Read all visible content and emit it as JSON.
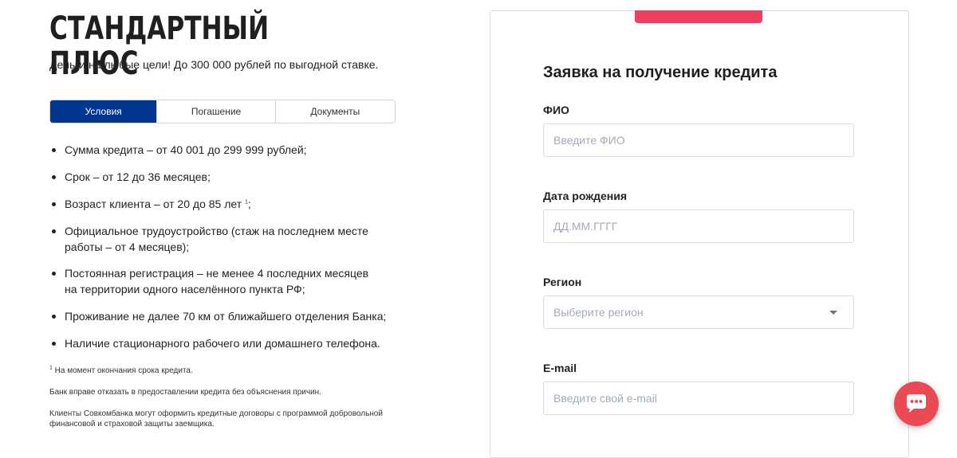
{
  "product": {
    "title": "СТАНДАРТНЫЙ ПЛЮС",
    "subtitle": "Деньги на любые цели! До 300 000 рублей по выгодной ставке."
  },
  "tabs": [
    {
      "label": "Условия",
      "active": true
    },
    {
      "label": "Погашение",
      "active": false
    },
    {
      "label": "Документы",
      "active": false
    }
  ],
  "conditions": [
    {
      "text": "Сумма кредита – от 40 001 до 299 999 рублей;"
    },
    {
      "text": "Срок – от 12 до 36 месяцев;"
    },
    {
      "text_before": "Возраст клиента – от 20 до 85 лет ",
      "footnote": "1",
      "text_after": ";"
    },
    {
      "text": "Официальное трудоустройство (стаж на последнем месте работы – от 4 месяцев);"
    },
    {
      "text": "Постоянная регистрация – не менее 4 последних месяцев на территории одного населённого пункта РФ;"
    },
    {
      "text": "Проживание не далее 70 км от ближайшего отделения Банка;"
    },
    {
      "text": "Наличие стационарного рабочего или домашнего телефона."
    }
  ],
  "notes": {
    "footnote_mark": "1",
    "footnote_text": " На момент окончания срока кредита.",
    "refusal": "Банк вправе отказать в предоставлении кредита без объяснения причин.",
    "insurance": "Клиенты Совкомбанка могут оформить кредитные договоры с программой добровольной финансовой и страховой защиты заемщика."
  },
  "form": {
    "title": "Заявка на получение кредита",
    "fio": {
      "label": "ФИО",
      "placeholder": "Введите ФИО",
      "value": ""
    },
    "birthdate": {
      "label": "Дата рождения",
      "placeholder": "ДД.ММ.ГГГГ",
      "value": ""
    },
    "region": {
      "label": "Регион",
      "placeholder": "Выберите регион"
    },
    "email": {
      "label": "E-mail",
      "placeholder": "Введите свой e-mail",
      "value": ""
    }
  },
  "colors": {
    "tab_active": "#003791",
    "form_accent": "#ef3f5e",
    "chat_button": "#ec4a53"
  },
  "icons": {
    "chat": "chat-bubble-icon",
    "select": "chevron-down-icon"
  }
}
